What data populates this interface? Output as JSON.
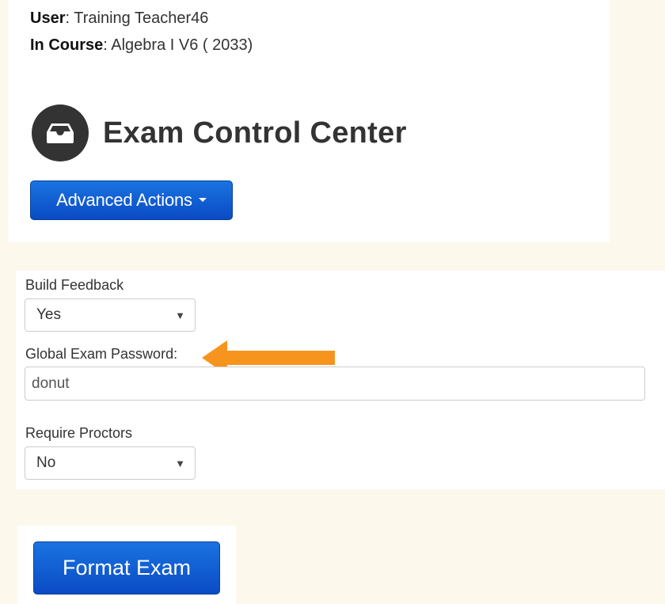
{
  "header": {
    "user_label": "User",
    "user_value": "Training Teacher46",
    "course_label": "In Course",
    "course_value": "Algebra I V6 ( 2033)",
    "title": "Exam Control Center",
    "title_icon": "inbox-tray-icon"
  },
  "toolbar": {
    "advanced_actions_label": "Advanced Actions"
  },
  "settings": {
    "build_feedback": {
      "label": "Build Feedback",
      "selected": "Yes"
    },
    "global_password": {
      "label": "Global Exam Password:",
      "value": "donut"
    },
    "require_proctors": {
      "label": "Require Proctors",
      "selected": "No"
    }
  },
  "annotation": {
    "arrow_color": "#f7941d",
    "arrow_icon": "left-arrow-icon"
  },
  "actions": {
    "format_exam_label": "Format Exam"
  },
  "colors": {
    "page_background": "#fdf8ec",
    "primary_button": "#0a4bc5",
    "title_text": "#333333"
  }
}
